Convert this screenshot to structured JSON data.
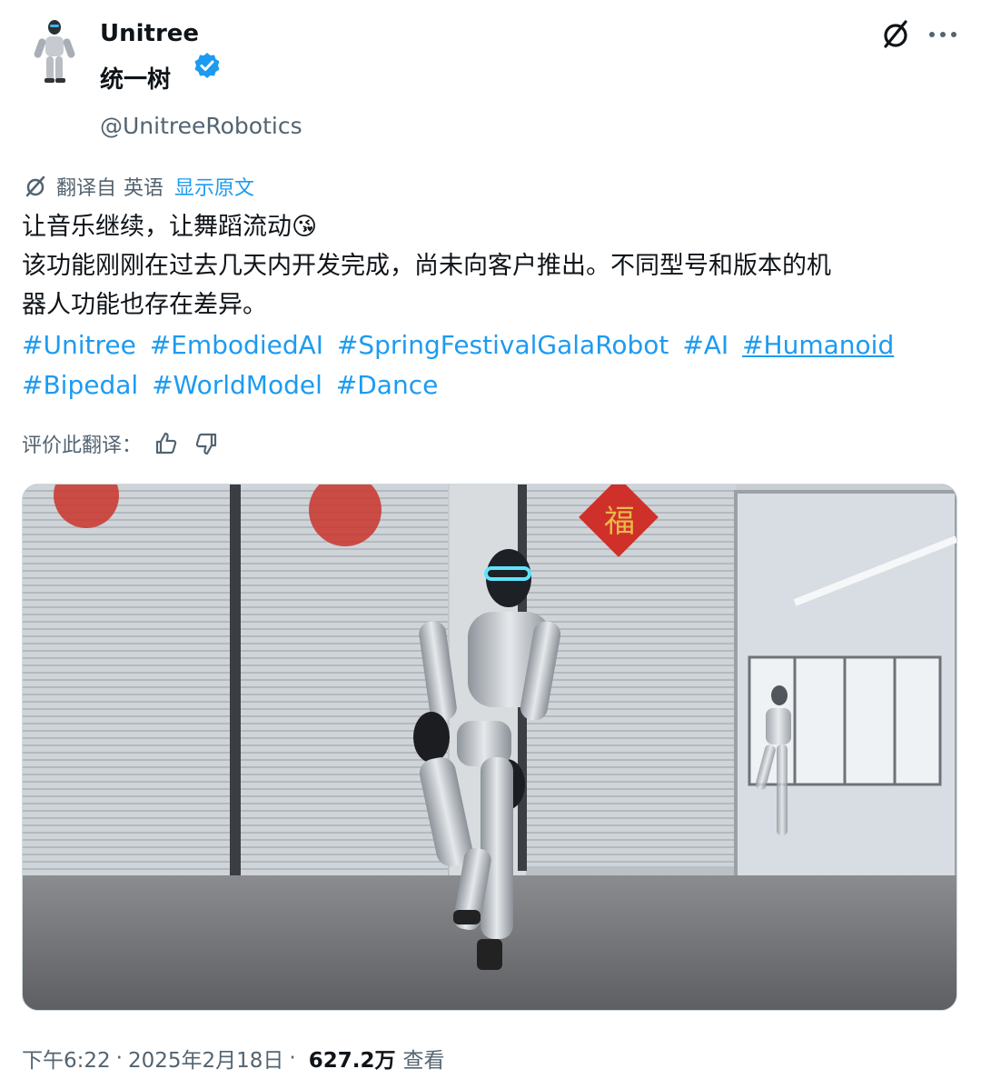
{
  "author": {
    "display_name": "Unitree",
    "cn_name": "统一树",
    "handle": "@UnitreeRobotics",
    "avatar_icon": "robot-avatar-icon",
    "verified_icon": "verified-badge-icon",
    "verified_color": "#1d9bf0"
  },
  "header_actions": {
    "grok_icon": "grok-icon",
    "more_icon": "more-dots-icon"
  },
  "translation": {
    "icon": "grok-translate-icon",
    "label": "翻译自",
    "language": "英语",
    "show_original": "显示原文"
  },
  "body": {
    "line1": "让音乐继续，让舞蹈流动😘",
    "line2": "该功能刚刚在过去几天内开发完成，尚未向客户推出。不同型号和版本的机",
    "line3": "器人功能也存在差异。"
  },
  "hashtags": [
    "#Unitree",
    "#EmbodiedAI",
    "#SpringFestivalGalaRobot",
    "#AI",
    "#Humanoid",
    "#Bipedal",
    "#WorldModel",
    "#Dance"
  ],
  "rating": {
    "label": "评价此翻译：",
    "thumbs_up_icon": "thumbs-up-icon",
    "thumbs_down_icon": "thumbs-down-icon"
  },
  "media": {
    "type": "video",
    "subject_icon": "dancing-humanoid-robot-image"
  },
  "footer": {
    "time": "下午6:22",
    "date": "2025年2月18日",
    "views": "627.2万",
    "views_label": "查看",
    "separator": "·"
  },
  "colors": {
    "link": "#1d9bf0",
    "muted": "#536471",
    "text": "#0f1419"
  }
}
